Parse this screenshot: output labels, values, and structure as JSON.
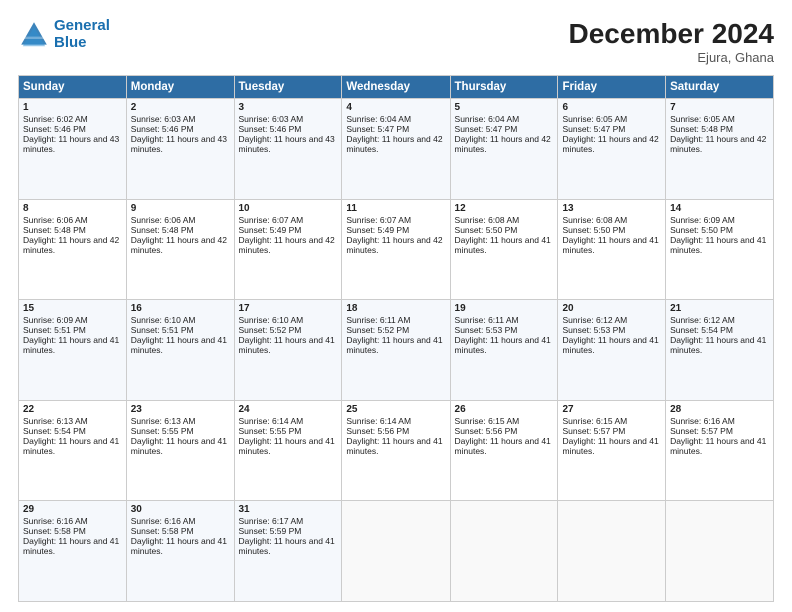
{
  "logo": {
    "line1": "General",
    "line2": "Blue"
  },
  "title": "December 2024",
  "location": "Ejura, Ghana",
  "weekdays": [
    "Sunday",
    "Monday",
    "Tuesday",
    "Wednesday",
    "Thursday",
    "Friday",
    "Saturday"
  ],
  "weeks": [
    [
      {
        "day": 1,
        "rise": "6:02 AM",
        "set": "5:46 PM",
        "daylight": "11 hours and 43 minutes."
      },
      {
        "day": 2,
        "rise": "6:03 AM",
        "set": "5:46 PM",
        "daylight": "11 hours and 43 minutes."
      },
      {
        "day": 3,
        "rise": "6:03 AM",
        "set": "5:46 PM",
        "daylight": "11 hours and 43 minutes."
      },
      {
        "day": 4,
        "rise": "6:04 AM",
        "set": "5:47 PM",
        "daylight": "11 hours and 42 minutes."
      },
      {
        "day": 5,
        "rise": "6:04 AM",
        "set": "5:47 PM",
        "daylight": "11 hours and 42 minutes."
      },
      {
        "day": 6,
        "rise": "6:05 AM",
        "set": "5:47 PM",
        "daylight": "11 hours and 42 minutes."
      },
      {
        "day": 7,
        "rise": "6:05 AM",
        "set": "5:48 PM",
        "daylight": "11 hours and 42 minutes."
      }
    ],
    [
      {
        "day": 8,
        "rise": "6:06 AM",
        "set": "5:48 PM",
        "daylight": "11 hours and 42 minutes."
      },
      {
        "day": 9,
        "rise": "6:06 AM",
        "set": "5:48 PM",
        "daylight": "11 hours and 42 minutes."
      },
      {
        "day": 10,
        "rise": "6:07 AM",
        "set": "5:49 PM",
        "daylight": "11 hours and 42 minutes."
      },
      {
        "day": 11,
        "rise": "6:07 AM",
        "set": "5:49 PM",
        "daylight": "11 hours and 42 minutes."
      },
      {
        "day": 12,
        "rise": "6:08 AM",
        "set": "5:50 PM",
        "daylight": "11 hours and 41 minutes."
      },
      {
        "day": 13,
        "rise": "6:08 AM",
        "set": "5:50 PM",
        "daylight": "11 hours and 41 minutes."
      },
      {
        "day": 14,
        "rise": "6:09 AM",
        "set": "5:50 PM",
        "daylight": "11 hours and 41 minutes."
      }
    ],
    [
      {
        "day": 15,
        "rise": "6:09 AM",
        "set": "5:51 PM",
        "daylight": "11 hours and 41 minutes."
      },
      {
        "day": 16,
        "rise": "6:10 AM",
        "set": "5:51 PM",
        "daylight": "11 hours and 41 minutes."
      },
      {
        "day": 17,
        "rise": "6:10 AM",
        "set": "5:52 PM",
        "daylight": "11 hours and 41 minutes."
      },
      {
        "day": 18,
        "rise": "6:11 AM",
        "set": "5:52 PM",
        "daylight": "11 hours and 41 minutes."
      },
      {
        "day": 19,
        "rise": "6:11 AM",
        "set": "5:53 PM",
        "daylight": "11 hours and 41 minutes."
      },
      {
        "day": 20,
        "rise": "6:12 AM",
        "set": "5:53 PM",
        "daylight": "11 hours and 41 minutes."
      },
      {
        "day": 21,
        "rise": "6:12 AM",
        "set": "5:54 PM",
        "daylight": "11 hours and 41 minutes."
      }
    ],
    [
      {
        "day": 22,
        "rise": "6:13 AM",
        "set": "5:54 PM",
        "daylight": "11 hours and 41 minutes."
      },
      {
        "day": 23,
        "rise": "6:13 AM",
        "set": "5:55 PM",
        "daylight": "11 hours and 41 minutes."
      },
      {
        "day": 24,
        "rise": "6:14 AM",
        "set": "5:55 PM",
        "daylight": "11 hours and 41 minutes."
      },
      {
        "day": 25,
        "rise": "6:14 AM",
        "set": "5:56 PM",
        "daylight": "11 hours and 41 minutes."
      },
      {
        "day": 26,
        "rise": "6:15 AM",
        "set": "5:56 PM",
        "daylight": "11 hours and 41 minutes."
      },
      {
        "day": 27,
        "rise": "6:15 AM",
        "set": "5:57 PM",
        "daylight": "11 hours and 41 minutes."
      },
      {
        "day": 28,
        "rise": "6:16 AM",
        "set": "5:57 PM",
        "daylight": "11 hours and 41 minutes."
      }
    ],
    [
      {
        "day": 29,
        "rise": "6:16 AM",
        "set": "5:58 PM",
        "daylight": "11 hours and 41 minutes."
      },
      {
        "day": 30,
        "rise": "6:16 AM",
        "set": "5:58 PM",
        "daylight": "11 hours and 41 minutes."
      },
      {
        "day": 31,
        "rise": "6:17 AM",
        "set": "5:59 PM",
        "daylight": "11 hours and 41 minutes."
      },
      null,
      null,
      null,
      null
    ]
  ]
}
